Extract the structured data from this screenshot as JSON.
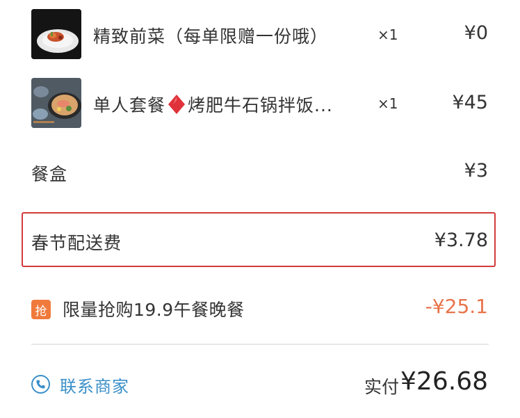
{
  "items": [
    {
      "name": "精致前菜（每单限赠一份哦）",
      "qty": "×1",
      "price": "¥0",
      "image": "appetizer-photo"
    },
    {
      "name_prefix": "单人套餐",
      "name_suffix": "烤肥牛石锅拌饭...",
      "qty": "×1",
      "price": "¥45",
      "image": "set-meal-photo",
      "icon": "red-diamond-icon"
    }
  ],
  "fees": {
    "box_label": "餐盒",
    "box_price": "¥3",
    "delivery_label": "春节配送费",
    "delivery_price": "¥3.78"
  },
  "promo": {
    "badge": "抢",
    "label": "限量抢购19.9午餐晚餐",
    "discount": "-¥25.1"
  },
  "footer": {
    "contact_label": "联系商家",
    "total_label": "实付",
    "total_value": "¥26.68"
  },
  "colors": {
    "highlight": "#d33a3a",
    "promo": "#e8734a",
    "badge": "#f07a3c",
    "link": "#3a8fc9"
  }
}
